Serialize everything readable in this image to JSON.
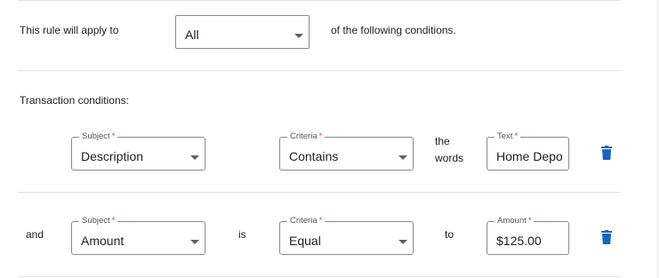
{
  "rule": {
    "apply_label": "This rule will apply to",
    "apply_value": "All",
    "following_label": "of the following conditions."
  },
  "transaction": {
    "heading": "Transaction conditions:",
    "rows": [
      {
        "prefix": "",
        "subject_legend": "Subject",
        "subject_value": "Description",
        "criteria_legend": "Criteria",
        "criteria_value": "Contains",
        "connector_line1": "the",
        "connector_line2": "words",
        "value_legend": "Text",
        "value": "Home Depo"
      },
      {
        "prefix": "and",
        "subject_legend": "Subject",
        "subject_value": "Amount",
        "middle": "is",
        "criteria_legend": "Criteria",
        "criteria_value": "Equal",
        "connector_line1": "to",
        "value_legend": "Amount",
        "value": "$125.00"
      }
    ]
  },
  "required_marker": "*",
  "colors": {
    "trash": "#1565c0",
    "required": "#e53935",
    "divider": "#e3e3e3"
  },
  "icons": {
    "delete": "trash-icon",
    "dropdown": "chevron-down-icon"
  }
}
